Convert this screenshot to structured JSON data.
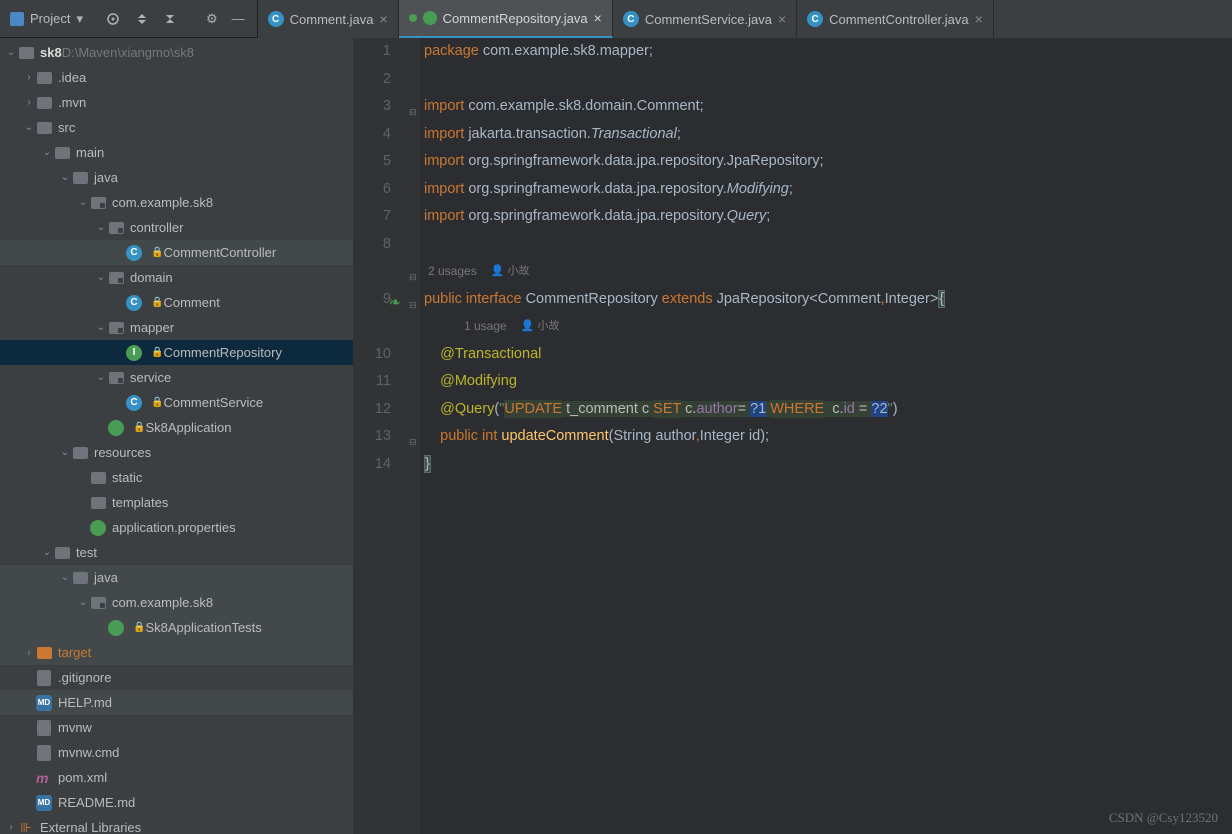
{
  "header": {
    "project_label": "Project"
  },
  "tabs": [
    {
      "name": "Comment.java",
      "type": "class",
      "active": false
    },
    {
      "name": "CommentRepository.java",
      "type": "interface",
      "active": true
    },
    {
      "name": "CommentService.java",
      "type": "class",
      "active": false
    },
    {
      "name": "CommentController.java",
      "type": "class",
      "active": false
    }
  ],
  "tree": {
    "root_name": "sk8",
    "root_path": "D:\\Maven\\xiangmo\\sk8",
    "items": [
      {
        "d": 1,
        "name": ".idea",
        "icon": "folder",
        "chev": ">"
      },
      {
        "d": 1,
        "name": ".mvn",
        "icon": "folder",
        "chev": ">"
      },
      {
        "d": 1,
        "name": "src",
        "icon": "folder",
        "chev": "v"
      },
      {
        "d": 2,
        "name": "main",
        "icon": "folder",
        "chev": "v"
      },
      {
        "d": 3,
        "name": "java",
        "icon": "folder",
        "chev": "v"
      },
      {
        "d": 4,
        "name": "com.example.sk8",
        "icon": "pkg",
        "chev": "v"
      },
      {
        "d": 5,
        "name": "controller",
        "icon": "pkg",
        "chev": "v"
      },
      {
        "d": 6,
        "name": "CommentController",
        "icon": "class",
        "lock": true,
        "hlt": true
      },
      {
        "d": 5,
        "name": "domain",
        "icon": "pkg",
        "chev": "v"
      },
      {
        "d": 6,
        "name": "Comment",
        "icon": "class",
        "lock": true
      },
      {
        "d": 5,
        "name": "mapper",
        "icon": "pkg",
        "chev": "v"
      },
      {
        "d": 6,
        "name": "CommentRepository",
        "icon": "intf",
        "lock": true,
        "sel": true
      },
      {
        "d": 5,
        "name": "service",
        "icon": "pkg",
        "chev": "v"
      },
      {
        "d": 6,
        "name": "CommentService",
        "icon": "class",
        "lock": true
      },
      {
        "d": 5,
        "name": "Sk8Application",
        "icon": "spring",
        "lock": true
      },
      {
        "d": 3,
        "name": "resources",
        "icon": "folder",
        "chev": "v"
      },
      {
        "d": 4,
        "name": "static",
        "icon": "folder",
        "chev": ""
      },
      {
        "d": 4,
        "name": "templates",
        "icon": "folder",
        "chev": ""
      },
      {
        "d": 4,
        "name": "application.properties",
        "icon": "spring",
        "chev": ""
      },
      {
        "d": 2,
        "name": "test",
        "icon": "folder",
        "chev": "v"
      },
      {
        "d": 3,
        "name": "java",
        "icon": "folder",
        "chev": "v",
        "hlt": true
      },
      {
        "d": 4,
        "name": "com.example.sk8",
        "icon": "pkg",
        "chev": "v",
        "hlt": true
      },
      {
        "d": 5,
        "name": "Sk8ApplicationTests",
        "icon": "spring",
        "lock": true,
        "hlt": true
      },
      {
        "d": 1,
        "name": "target",
        "icon": "folder-o",
        "chev": ">",
        "hlt": true,
        "orng": true
      },
      {
        "d": 1,
        "name": ".gitignore",
        "icon": "file",
        "chev": ""
      },
      {
        "d": 1,
        "name": "HELP.md",
        "icon": "md",
        "chev": "",
        "hlt": true
      },
      {
        "d": 1,
        "name": "mvnw",
        "icon": "file",
        "chev": ""
      },
      {
        "d": 1,
        "name": "mvnw.cmd",
        "icon": "file",
        "chev": ""
      },
      {
        "d": 1,
        "name": "pom.xml",
        "icon": "m",
        "chev": ""
      },
      {
        "d": 1,
        "name": "README.md",
        "icon": "md",
        "chev": ""
      }
    ],
    "external": "External Libraries"
  },
  "editor": {
    "usages1": "2 usages",
    "author1": "小故",
    "usages2": "1 usage",
    "author2": "小故",
    "code": {
      "l1_pkg": "package",
      "l1_path": "com.example.sk8.mapper",
      "imp": "import",
      "i1": "com.example.sk8.domain.Comment",
      "i2": "jakarta.transaction.",
      "i2b": "Transactional",
      "i3": "org.springframework.data.jpa.repository.JpaRepository",
      "i4": "org.springframework.data.jpa.repository.",
      "i4b": "Modifying",
      "i5": "org.springframework.data.jpa.repository.",
      "i5b": "Query",
      "pub": "public",
      "intf": "interface",
      "cname": "CommentRepository",
      "ext": "extends",
      "parent": "JpaRepository",
      "g1": "Comment",
      "g2": "Integer",
      "a1": "@Transactional",
      "a2": "@Modifying",
      "a3": "@Query",
      "sql_update": "UPDATE",
      "sql_tbl": "t_comment",
      "sql_c": "c",
      "sql_set": "SET",
      "sql_col": "author",
      "sql_where": "WHERE",
      "sql_id": "id",
      "ret": "int",
      "mname": "updateComment",
      "p1t": "String",
      "p1n": "author",
      "p2t": "Integer",
      "p2n": "id"
    },
    "lines": [
      1,
      2,
      3,
      4,
      5,
      6,
      7,
      8,
      "",
      9,
      "",
      10,
      11,
      12,
      13,
      14
    ]
  },
  "watermark": "CSDN @Csy123520"
}
